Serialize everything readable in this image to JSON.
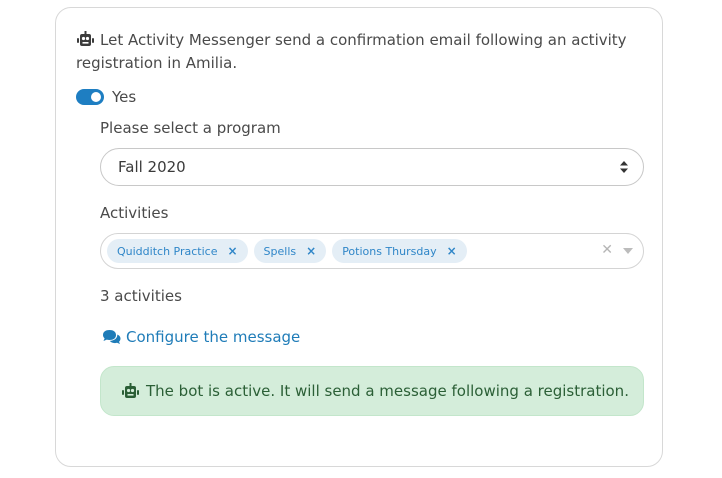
{
  "intro": {
    "text": "Let Activity Messenger send a confirmation email following an activity registration in Amilia."
  },
  "toggle": {
    "label": "Yes",
    "state": "on"
  },
  "program": {
    "label": "Please select a program",
    "selected": "Fall 2020"
  },
  "activities": {
    "label": "Activities",
    "chips": [
      "Quidditch Practice",
      "Spells",
      "Potions Thursday"
    ],
    "count_text": "3 activities"
  },
  "configure": {
    "link_text": "Configure the message"
  },
  "alert": {
    "text": "The bot is active. It will send a message following a registration."
  },
  "colors": {
    "accent": "#1e7ec2",
    "chip_bg": "#e4eef6",
    "success_bg": "#d4edda",
    "success_text": "#2b5f36"
  },
  "icons": {
    "bot": "robot-icon",
    "comments": "comments-icon",
    "sort": "sort-icon",
    "clear": "clear-icon",
    "caret": "caret-down-icon"
  }
}
